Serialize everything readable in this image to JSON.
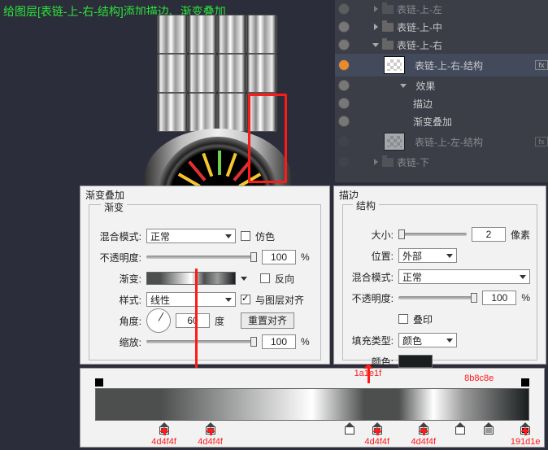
{
  "title": "给图层[表链-上-右-结构]添加描边、渐变叠加",
  "layers": {
    "items": [
      {
        "label": "表链-上-左",
        "kind": "folder",
        "collapsed": true,
        "vis": true
      },
      {
        "label": "表链-上-中",
        "kind": "folder",
        "collapsed": true,
        "vis": true
      },
      {
        "label": "表链-上-右",
        "kind": "folder",
        "collapsed": false,
        "vis": true
      },
      {
        "label": "表链-上-右-结构",
        "kind": "layer",
        "selected": true,
        "vis": true,
        "fx": true
      },
      {
        "label": "效果",
        "kind": "fxhead",
        "vis": true
      },
      {
        "label": "描边",
        "kind": "fx",
        "vis": true
      },
      {
        "label": "渐变叠加",
        "kind": "fx",
        "vis": true
      },
      {
        "label": "表链-上-左-结构",
        "kind": "layer",
        "vis": false,
        "fx": true
      },
      {
        "label": "表链-下",
        "kind": "folder",
        "collapsed": true,
        "vis": false
      }
    ]
  },
  "go": {
    "panel_title": "渐变叠加",
    "legend": "渐变",
    "blend_lbl": "混合模式:",
    "blend_val": "正常",
    "dither_lbl": "仿色",
    "opacity_lbl": "不透明度:",
    "opacity_val": "100",
    "pct": "%",
    "grad_lbl": "渐变:",
    "reverse_lbl": "反向",
    "style_lbl": "样式:",
    "style_val": "线性",
    "align_lbl": "与图层对齐",
    "angle_lbl": "角度:",
    "angle_val": "60",
    "deg": "度",
    "reset_btn": "重置对齐",
    "scale_lbl": "缩放:",
    "scale_val": "100"
  },
  "st": {
    "panel_title": "描边",
    "legend": "结构",
    "size_lbl": "大小:",
    "size_val": "2",
    "px": "像素",
    "pos_lbl": "位置:",
    "pos_val": "外部",
    "blend_lbl": "混合模式:",
    "blend_val": "正常",
    "opacity_lbl": "不透明度:",
    "opacity_val": "100",
    "pct": "%",
    "overprint_lbl": "叠印",
    "fill_lbl": "填充类型:",
    "fill_val": "颜色",
    "color_lbl": "颜色:"
  },
  "stops": {
    "top_label": "1a1e1f",
    "mid_label": "8b8c8e",
    "bottom": [
      {
        "pos": 18,
        "color": "#4d4f4f",
        "label": "4d4f4f"
      },
      {
        "pos": 28,
        "color": "#4d4f4f",
        "label": "4d4f4f"
      },
      {
        "pos": 58,
        "color": "#ffffff",
        "label": ""
      },
      {
        "pos": 64,
        "color": "#4d4f4f",
        "label": "4d4f4f"
      },
      {
        "pos": 74,
        "color": "#4d4f4f",
        "label": "4d4f4f"
      },
      {
        "pos": 82,
        "color": "#ffffff",
        "label": ""
      },
      {
        "pos": 88,
        "color": "#9a9a9a",
        "label": ""
      },
      {
        "pos": 96,
        "color": "#1a1e1f",
        "label": "191d1e"
      }
    ]
  }
}
